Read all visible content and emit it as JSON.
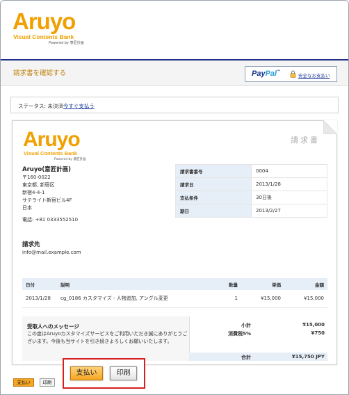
{
  "brand": {
    "name": "Aruyo",
    "tagline": "Visual Contents Bank",
    "powered": "Powered by 意匠計画",
    "color": "#f0a000"
  },
  "subheader": {
    "title": "請求書を確認する",
    "paypal_pay": "Pay",
    "paypal_pal": "Pal",
    "paypal_tm": "™",
    "secure_link": "安全なお支払い"
  },
  "status": {
    "prefix": "ステータス: 未決済",
    "link": "今すぐ支払う"
  },
  "invoice": {
    "title": "請求書",
    "company": {
      "name": "Aruyo(意匠計画)",
      "lines": [
        "〒160-0022",
        "東京都, 新宿区",
        "新宿4-4-1",
        "サテライト新宿ビル4F",
        "日本"
      ],
      "phone": "電話: +81 0333552510"
    },
    "meta": [
      {
        "label": "請求書番号",
        "value": "0004"
      },
      {
        "label": "請求日",
        "value": "2013/1/28"
      },
      {
        "label": "支払条件",
        "value": "30日後"
      },
      {
        "label": "期日",
        "value": "2013/2/27"
      }
    ],
    "bill_to": {
      "label": "請求先",
      "email": "info@mail.example.com"
    },
    "items": {
      "headers": {
        "date": "日付",
        "desc": "説明",
        "qty": "数量",
        "unit": "単価",
        "amount": "金額"
      },
      "rows": [
        {
          "date": "2013/1/28",
          "desc": "cg_0186 カスタマイズ - 人物追加, アングル変更",
          "qty": "1",
          "unit": "¥15,000",
          "amount": "¥15,000"
        }
      ]
    },
    "message": {
      "title": "受取人へのメッセージ",
      "body": "この度はAruyoカスタマイズサービスをご利用いただき誠にありがとうございます。今後も当サイトを引き続きよろしくお願いいたします。"
    },
    "totals": {
      "subtotal_label": "小計",
      "subtotal": "¥15,000",
      "tax_label": "消費税5%",
      "tax": "¥750",
      "total_label": "合計",
      "total": "¥15,750 JPY"
    }
  },
  "buttons": {
    "pay": "支払い",
    "print": "印刷"
  },
  "colors": {
    "accent_orange": "#f5a623",
    "header_line": "#1f2f86",
    "highlight_border": "#d42020",
    "table_header_bg": "#e6eef8"
  }
}
